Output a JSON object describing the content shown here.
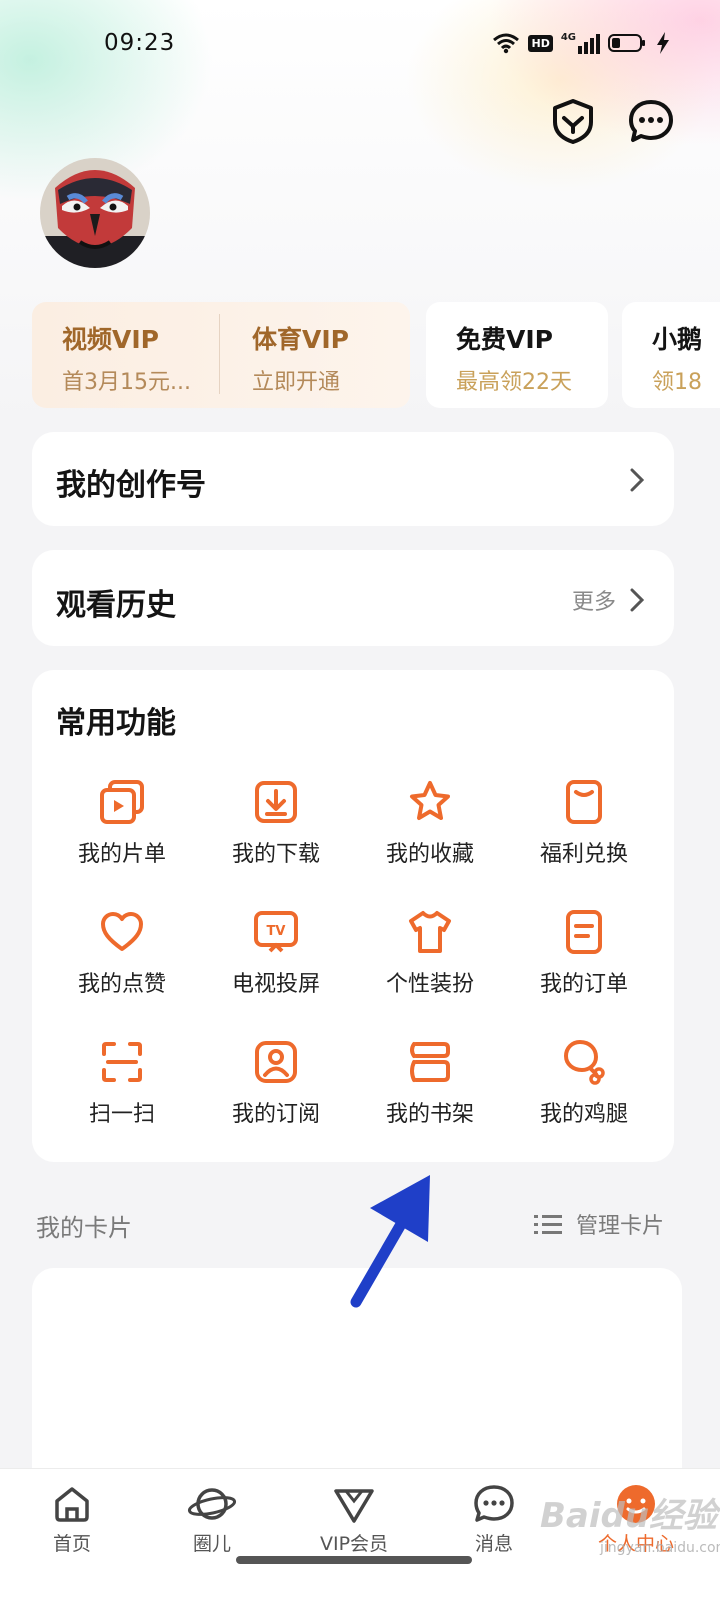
{
  "status_bar": {
    "time": "09:23",
    "network": "4G",
    "hd": "HD"
  },
  "top_actions": {
    "shield": "shield-icon",
    "message": "chat-icon"
  },
  "vip_cards": [
    {
      "title": "视频VIP",
      "subtitle": "首3月15元...",
      "title_color": "#a0672a",
      "sub_color": "#b48a5a"
    },
    {
      "title": "体育VIP",
      "subtitle": "立即开通",
      "title_color": "#a0672a",
      "sub_color": "#b48a5a"
    },
    {
      "title": "免费VIP",
      "subtitle": "最高领22天",
      "title_color": "#141414",
      "sub_color": "#c9a15a"
    },
    {
      "title": "小鹅",
      "subtitle": "领18",
      "title_color": "#141414",
      "sub_color": "#c9a15a"
    }
  ],
  "creator": {
    "title": "我的创作号"
  },
  "history": {
    "title": "观看历史",
    "more": "更多"
  },
  "functions": {
    "title": "常用功能",
    "items": [
      {
        "label": "我的片单",
        "icon": "playlist-icon"
      },
      {
        "label": "我的下载",
        "icon": "download-icon"
      },
      {
        "label": "我的收藏",
        "icon": "star-icon"
      },
      {
        "label": "福利兑换",
        "icon": "coupon-icon"
      },
      {
        "label": "我的点赞",
        "icon": "heart-icon"
      },
      {
        "label": "电视投屏",
        "icon": "tv-icon"
      },
      {
        "label": "个性装扮",
        "icon": "tshirt-icon"
      },
      {
        "label": "我的订单",
        "icon": "order-icon"
      },
      {
        "label": "扫一扫",
        "icon": "scan-icon"
      },
      {
        "label": "我的订阅",
        "icon": "subscribe-icon"
      },
      {
        "label": "我的书架",
        "icon": "bookshelf-icon"
      },
      {
        "label": "我的鸡腿",
        "icon": "drumstick-icon"
      }
    ]
  },
  "cards_section": {
    "title": "我的卡片",
    "manage": "管理卡片"
  },
  "nav": {
    "items": [
      {
        "label": "首页",
        "icon": "home-icon"
      },
      {
        "label": "圈儿",
        "icon": "planet-icon"
      },
      {
        "label": "VIP会员",
        "icon": "vip-icon"
      },
      {
        "label": "消息",
        "icon": "message-icon"
      },
      {
        "label": "个人中心",
        "icon": "profile-icon",
        "active": true
      }
    ]
  },
  "colors": {
    "accent": "#ee6a2c",
    "arrow": "#1f3fc8",
    "vip_gold": "#a0672a"
  },
  "watermark": {
    "text": "Baidu经验",
    "sub": "jingyan.baidu.com"
  }
}
